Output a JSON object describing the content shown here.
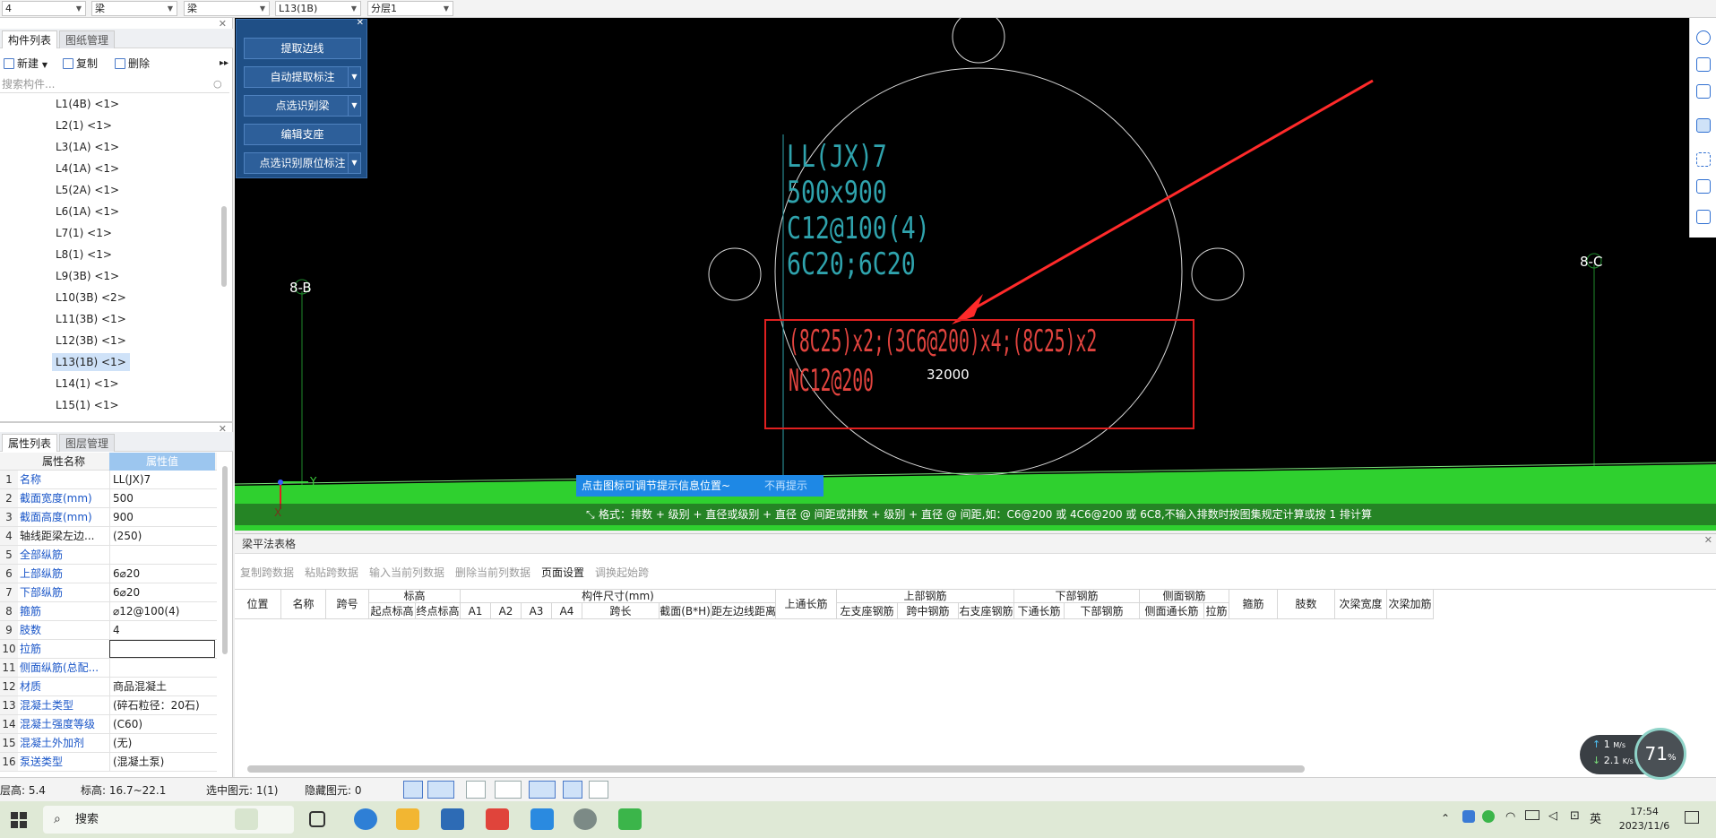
{
  "topbar": {
    "selectors": [
      "4",
      "梁",
      "梁",
      "L13(1B)",
      "分层1"
    ]
  },
  "component_panel": {
    "tabs": [
      "构件列表",
      "图纸管理"
    ],
    "toolbar": {
      "new": "新建",
      "copy": "复制",
      "delete": "删除"
    },
    "search_placeholder": "搜索构件...",
    "items": [
      "L1(4B) <1>",
      "L2(1) <1>",
      "L3(1A) <1>",
      "L4(1A) <1>",
      "L5(2A) <1>",
      "L6(1A) <1>",
      "L7(1) <1>",
      "L8(1) <1>",
      "L9(3B) <1>",
      "L10(3B) <2>",
      "L11(3B) <1>",
      "L12(3B) <1>",
      "L13(1B) <1>",
      "L14(1) <1>",
      "L15(1) <1>"
    ],
    "selected_index": 12
  },
  "property_panel": {
    "tabs": [
      "属性列表",
      "图层管理"
    ],
    "headers": [
      "属性名称",
      "属性值"
    ],
    "rows": [
      {
        "n": "1",
        "name": "名称",
        "value": "LL(JX)7",
        "blue": true
      },
      {
        "n": "2",
        "name": "截面宽度(mm)",
        "value": "500",
        "blue": true
      },
      {
        "n": "3",
        "name": "截面高度(mm)",
        "value": "900",
        "blue": true
      },
      {
        "n": "4",
        "name": "轴线距梁左边...",
        "value": "(250)",
        "blue": false
      },
      {
        "n": "5",
        "name": "全部纵筋",
        "value": "",
        "blue": true
      },
      {
        "n": "6",
        "name": "上部纵筋",
        "value": "6⌀20",
        "blue": true
      },
      {
        "n": "7",
        "name": "下部纵筋",
        "value": "6⌀20",
        "blue": true
      },
      {
        "n": "8",
        "name": "箍筋",
        "value": "⌀12@100(4)",
        "blue": true
      },
      {
        "n": "9",
        "name": "肢数",
        "value": "4",
        "blue": true
      },
      {
        "n": "10",
        "name": "拉筋",
        "value": "",
        "blue": true
      },
      {
        "n": "11",
        "name": "侧面纵筋(总配...",
        "value": "",
        "blue": true
      },
      {
        "n": "12",
        "name": "材质",
        "value": "商品混凝土",
        "blue": true
      },
      {
        "n": "13",
        "name": "混凝土类型",
        "value": "(碎石粒径：20石)",
        "blue": true
      },
      {
        "n": "14",
        "name": "混凝土强度等级",
        "value": "(C60)",
        "blue": true
      },
      {
        "n": "15",
        "name": "混凝土外加剂",
        "value": "(无)",
        "blue": true
      },
      {
        "n": "16",
        "name": "泵送类型",
        "value": "(混凝土泵)",
        "blue": true
      }
    ]
  },
  "tool_panel": {
    "buttons": [
      "提取边线",
      "自动提取标注",
      "点选识别梁",
      "编辑支座",
      "点选识别原位标注"
    ]
  },
  "canvas": {
    "annotation_lines": [
      "LL(JX)7",
      "500x900",
      "C12@100(4)",
      "6C20;6C20"
    ],
    "highlight_lines": [
      "(8C25)x2;(3C6@200)x4;(8C25)x2",
      "NC12@200"
    ],
    "dimension": "32000",
    "axis_left": "8-B",
    "axis_right": "8-C",
    "tooltip": "点击图标可调节提示信息位置~",
    "tooltip_dismiss": "不再提示",
    "hint": "格式：排数 + 级别 + 直径或级别 + 直径 @ 间距或排数 + 级别 + 直径 @ 间距,如：C6@200 或 4C6@200 或 6C8,不输入排数时按图集规定计算或按 1 排计算",
    "ucs_x": "X",
    "ucs_y": "Y"
  },
  "beam_table": {
    "title": "梁平法表格",
    "toolbar": [
      "复制跨数据",
      "粘贴跨数据",
      "输入当前列数据",
      "删除当前列数据",
      "页面设置",
      "调换起始跨"
    ],
    "group_headers": [
      "标高",
      "构件尺寸(mm)",
      "上部钢筋",
      "下部钢筋",
      "侧面钢筋"
    ],
    "columns": [
      "位置",
      "名称",
      "跨号",
      "起点标高",
      "终点标高",
      "A1",
      "A2",
      "A3",
      "A4",
      "跨长",
      "截面(B*H)",
      "距左边线距离",
      "上通长筋",
      "左支座钢筋",
      "跨中钢筋",
      "右支座钢筋",
      "下通长筋",
      "下部钢筋",
      "侧面通长筋",
      "拉筋",
      "箍筋",
      "肢数",
      "次梁宽度",
      "次梁加筋"
    ]
  },
  "statusbar": {
    "floor_height": "层高:   5.4",
    "elevation": "标高:   16.7~22.1",
    "selected": "选中图元:  1(1)",
    "hidden": "隐藏图元:  0"
  },
  "network": {
    "up": "1",
    "up_unit": "M/s",
    "down": "2.1",
    "down_unit": "K/s",
    "percent": "71",
    "percent_sign": "%"
  },
  "taskbar": {
    "search": "搜索",
    "time": "17:54",
    "date": "2023/11/6",
    "ime": "英"
  },
  "colors": {
    "canvas_bg": "#000000",
    "cyan_text": "#2fa3ad",
    "red_text": "#e2443f",
    "green_band": "#2fd02f",
    "tool_panel": "#1f4f86",
    "tooltip_bg": "#1e88e5"
  }
}
